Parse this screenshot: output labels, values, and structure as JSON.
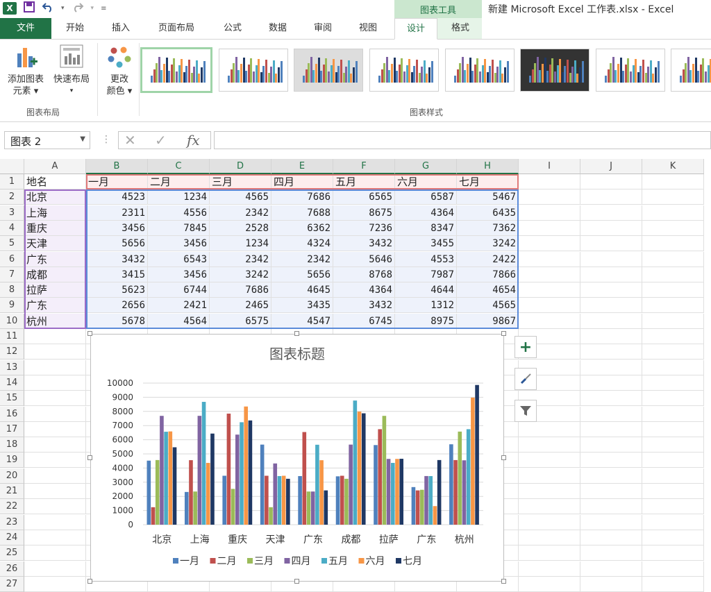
{
  "window": {
    "title": "新建 Microsoft Excel 工作表.xlsx - Excel",
    "context_tab_group": "图表工具"
  },
  "qat": {
    "logo": "X",
    "save_icon": "save-icon",
    "undo_icon": "undo-icon",
    "redo_icon": "redo-icon"
  },
  "tabs": [
    "文件",
    "开始",
    "插入",
    "页面布局",
    "公式",
    "数据",
    "审阅",
    "视图",
    "设计",
    "格式"
  ],
  "ribbon": {
    "add_element_line1": "添加图表",
    "add_element_line2": "元素",
    "quick_layout": "快速布局",
    "change_colors_line1": "更改",
    "change_colors_line2": "颜色",
    "group_layout": "图表布局",
    "group_styles": "图表样式"
  },
  "formula_bar": {
    "name_box": "图表 2",
    "formula": ""
  },
  "columns": [
    "A",
    "B",
    "C",
    "D",
    "E",
    "F",
    "G",
    "H",
    "I",
    "J",
    "K"
  ],
  "rows": [
    "1",
    "2",
    "3",
    "4",
    "5",
    "6",
    "7",
    "8",
    "9",
    "10",
    "11",
    "12",
    "13",
    "14",
    "15",
    "16",
    "17",
    "18",
    "19",
    "20",
    "21",
    "22",
    "23",
    "24",
    "25",
    "26",
    "27"
  ],
  "sheet": {
    "header": [
      "地名",
      "一月",
      "二月",
      "三月",
      "四月",
      "五月",
      "六月",
      "七月"
    ],
    "data": [
      [
        "北京",
        "4523",
        "1234",
        "4565",
        "7686",
        "6565",
        "6587",
        "5467"
      ],
      [
        "上海",
        "2311",
        "4556",
        "2342",
        "7688",
        "8675",
        "4364",
        "6435"
      ],
      [
        "重庆",
        "3456",
        "7845",
        "2528",
        "6362",
        "7236",
        "8347",
        "7362"
      ],
      [
        "天津",
        "5656",
        "3456",
        "1234",
        "4324",
        "3432",
        "3455",
        "3242"
      ],
      [
        "广东",
        "3432",
        "6543",
        "2342",
        "2342",
        "5646",
        "4553",
        "2422"
      ],
      [
        "成都",
        "3415",
        "3456",
        "3242",
        "5656",
        "8768",
        "7987",
        "7866"
      ],
      [
        "拉萨",
        "5623",
        "6744",
        "7686",
        "4645",
        "4364",
        "4644",
        "4654"
      ],
      [
        "广东",
        "2656",
        "2421",
        "2465",
        "3435",
        "3432",
        "1312",
        "4565"
      ],
      [
        "杭州",
        "5678",
        "4564",
        "6575",
        "4547",
        "6745",
        "8975",
        "9867"
      ]
    ]
  },
  "chart_data": {
    "type": "bar",
    "title": "图表标题",
    "categories": [
      "北京",
      "上海",
      "重庆",
      "天津",
      "广东",
      "成都",
      "拉萨",
      "广东",
      "杭州"
    ],
    "series": [
      {
        "name": "一月",
        "color": "#4f81bd",
        "values": [
          4523,
          2311,
          3456,
          5656,
          3432,
          3415,
          5623,
          2656,
          5678
        ]
      },
      {
        "name": "二月",
        "color": "#c0504d",
        "values": [
          1234,
          4556,
          7845,
          3456,
          6543,
          3456,
          6744,
          2421,
          4564
        ]
      },
      {
        "name": "三月",
        "color": "#9bbb59",
        "values": [
          4565,
          2342,
          2528,
          1234,
          2342,
          3242,
          7686,
          2465,
          6575
        ]
      },
      {
        "name": "四月",
        "color": "#8064a2",
        "values": [
          7686,
          7688,
          6362,
          4324,
          2342,
          5656,
          4645,
          3435,
          4547
        ]
      },
      {
        "name": "五月",
        "color": "#4bacc6",
        "values": [
          6565,
          8675,
          7236,
          3432,
          5646,
          8768,
          4364,
          3432,
          6745
        ]
      },
      {
        "name": "六月",
        "color": "#f79646",
        "values": [
          6587,
          4364,
          8347,
          3455,
          4553,
          7987,
          4644,
          1312,
          8975
        ]
      },
      {
        "name": "七月",
        "color": "#1f3864",
        "values": [
          5467,
          6435,
          7362,
          3242,
          2422,
          7866,
          4654,
          4565,
          9867
        ]
      }
    ],
    "ylim": [
      0,
      10000
    ],
    "yticks": [
      0,
      1000,
      2000,
      3000,
      4000,
      5000,
      6000,
      7000,
      8000,
      9000,
      10000
    ],
    "grid": true,
    "legend": "bottom"
  },
  "chart_side_buttons": [
    "plus-icon",
    "brush-icon",
    "filter-icon"
  ]
}
